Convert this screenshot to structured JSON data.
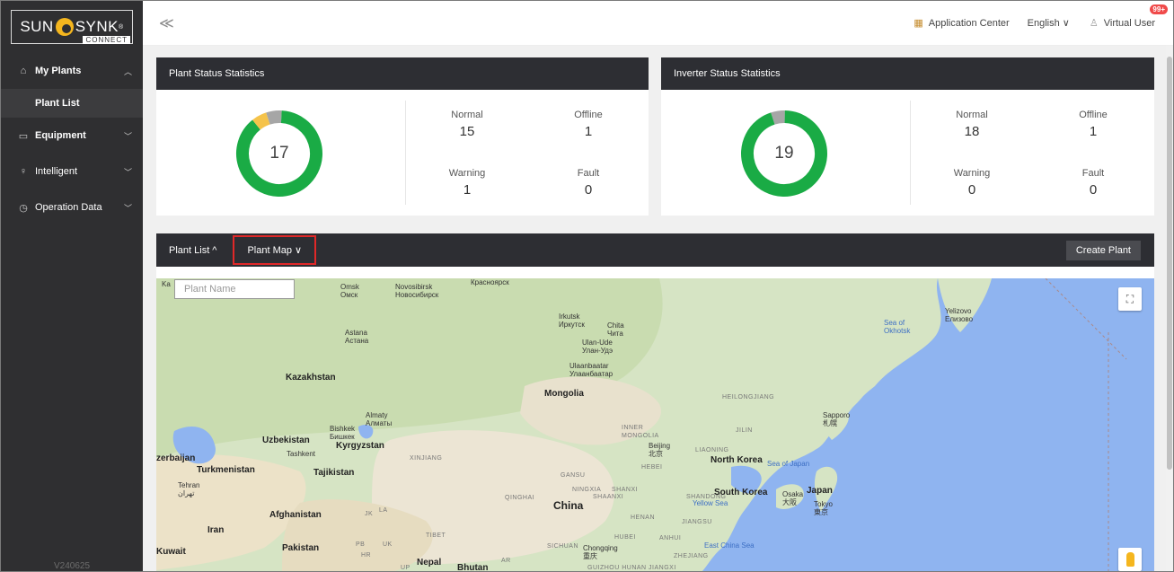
{
  "brand": {
    "name_left": "SUN",
    "name_right": "SYNK",
    "tm": "®",
    "sub": "CONNECT",
    "color": "#f5b61e"
  },
  "sidebar": {
    "items": [
      {
        "label": "My Plants",
        "icon": "home-icon"
      },
      {
        "label": "Plant List"
      },
      {
        "label": "Equipment",
        "icon": "equipment-icon"
      },
      {
        "label": "Intelligent",
        "icon": "bulb-icon"
      },
      {
        "label": "Operation Data",
        "icon": "clock-icon"
      }
    ],
    "version": "V240625"
  },
  "topbar": {
    "collapse": "≪",
    "app_center": "Application Center",
    "language": "English",
    "user": "Virtual User",
    "badge": "99+"
  },
  "plant_stats": {
    "title": "Plant Status Statistics",
    "total": "17",
    "normal_label": "Normal",
    "normal": "15",
    "offline_label": "Offline",
    "offline": "1",
    "warning_label": "Warning",
    "warning": "1",
    "fault_label": "Fault",
    "fault": "0"
  },
  "inverter_stats": {
    "title": "Inverter Status Statistics",
    "total": "19",
    "normal_label": "Normal",
    "normal": "18",
    "offline_label": "Offline",
    "offline": "1",
    "warning_label": "Warning",
    "warning": "0",
    "fault_label": "Fault",
    "fault": "0"
  },
  "colors": {
    "normal": "#1aab45",
    "warning": "#f5c34a",
    "offline": "#a6a6a6",
    "fault": "#e04545",
    "header": "#2d2e33"
  },
  "plant_panel": {
    "tab_list": "Plant List ^",
    "tab_map": "Plant Map ∨",
    "create": "Create Plant",
    "search_placeholder": "Plant Name"
  },
  "map_labels": {
    "omsk": "Omsk\nОмск",
    "novosibirsk": "Novosibirsk\nНовосибирск",
    "krasnoyarsk": "Красноярск",
    "irkutsk": "Irkutsk\nИркутск",
    "chita": "Chita\nЧита",
    "ulan_ude": "Ulan-Ude\nУлан-Удэ",
    "astana": "Astana\nАстана",
    "kazakhstan": "Kazakhstan",
    "ulaanbaatar": "Ulaanbaatar\nУлаанбаатар",
    "mongolia": "Mongolia",
    "heilongjiang": "HEILONGJIANG",
    "sea_okhotsk": "Sea of\nOkhotsk",
    "yelizovo": "Yelizovo\nЕлизово",
    "sapporo": "Sapporo\n札幌",
    "almaty": "Almaty\nАлматы",
    "bishkek": "Bishkek\nБишкек",
    "uzbekistan": "Uzbekistan",
    "kyrgyzstan": "Kyrgyzstan",
    "tashkent": "Tashkent",
    "azerbaijan": "zerbaijan",
    "turkmenistan": "Turkmenistan",
    "tajikistan": "Tajikistan",
    "xinjiang": "XINJIANG",
    "inner_mongolia": "INNER\nMONGOLIA",
    "jilin": "JILIN",
    "beijing": "Beijing\n北京",
    "liaoning": "LIAONING",
    "hebei": "HEBEI",
    "north_korea": "North Korea",
    "sea_japan": "Sea of Japan",
    "tehran": "Tehran\nتهران",
    "gansu": "GANSU",
    "ningxia": "NINGXIA",
    "shanxi": "SHANXI",
    "shaanxi": "SHAANXI",
    "shandong": "SHANDONG",
    "south_korea": "South Korea",
    "yellow_sea": "Yellow Sea",
    "osaka": "Osaka\n大阪",
    "japan": "Japan",
    "tokyo": "Tokyo\n東京",
    "qinghai": "QINGHAI",
    "china": "China",
    "henan": "HENAN",
    "jiangsu": "JIANGSU",
    "afghanistan": "Afghanistan",
    "iran": "Iran",
    "tibet": "TIBET",
    "hubei": "HUBEI",
    "anhui": "ANHUI",
    "east_china_sea": "East China Sea",
    "pakistan": "Pakistan",
    "sichuan": "SICHUAN",
    "chongqing": "Chongqing\n重庆",
    "zhejiang": "ZHEJIANG",
    "kuwait": "Kuwait",
    "nepal": "Nepal",
    "bhutan": "Bhutan",
    "guizhou": "GUIZHOU HUNAN JIANGXI",
    "jk": "JK",
    "la": "LA",
    "pb": "PB",
    "uk": "UK",
    "hr": "HR",
    "up": "UP",
    "ar": "AR",
    "ka": "Ka"
  }
}
